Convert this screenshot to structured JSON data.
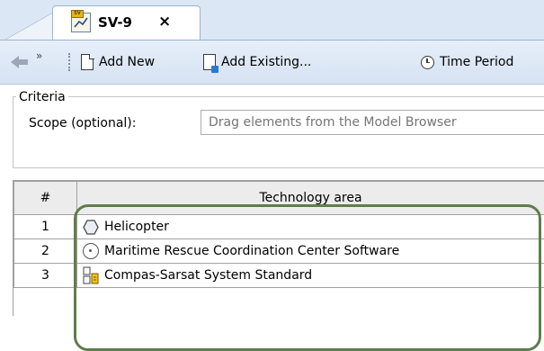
{
  "tab": {
    "title": "SV-9",
    "close": "×",
    "icon_badge": "SV"
  },
  "toolbar": {
    "overflow": "»",
    "add_new": "Add New",
    "add_existing": "Add Existing...",
    "time_period": "Time Period"
  },
  "criteria": {
    "legend": "Criteria",
    "scope_label": "Scope (optional):",
    "scope_placeholder": "Drag elements from the Model Browser"
  },
  "table": {
    "columns": [
      "#",
      "Technology area"
    ],
    "rows": [
      {
        "num": "1",
        "name": "Helicopter",
        "icon": "hexagon-icon"
      },
      {
        "num": "2",
        "name": "Maritime Rescue Coordination Center Software",
        "icon": "software-icon"
      },
      {
        "num": "3",
        "name": "Compas-Sarsat System Standard",
        "icon": "standard-icon"
      }
    ]
  },
  "colors": {
    "highlight": "#5f7d4d",
    "tabstrip": "#dbe7f5"
  }
}
